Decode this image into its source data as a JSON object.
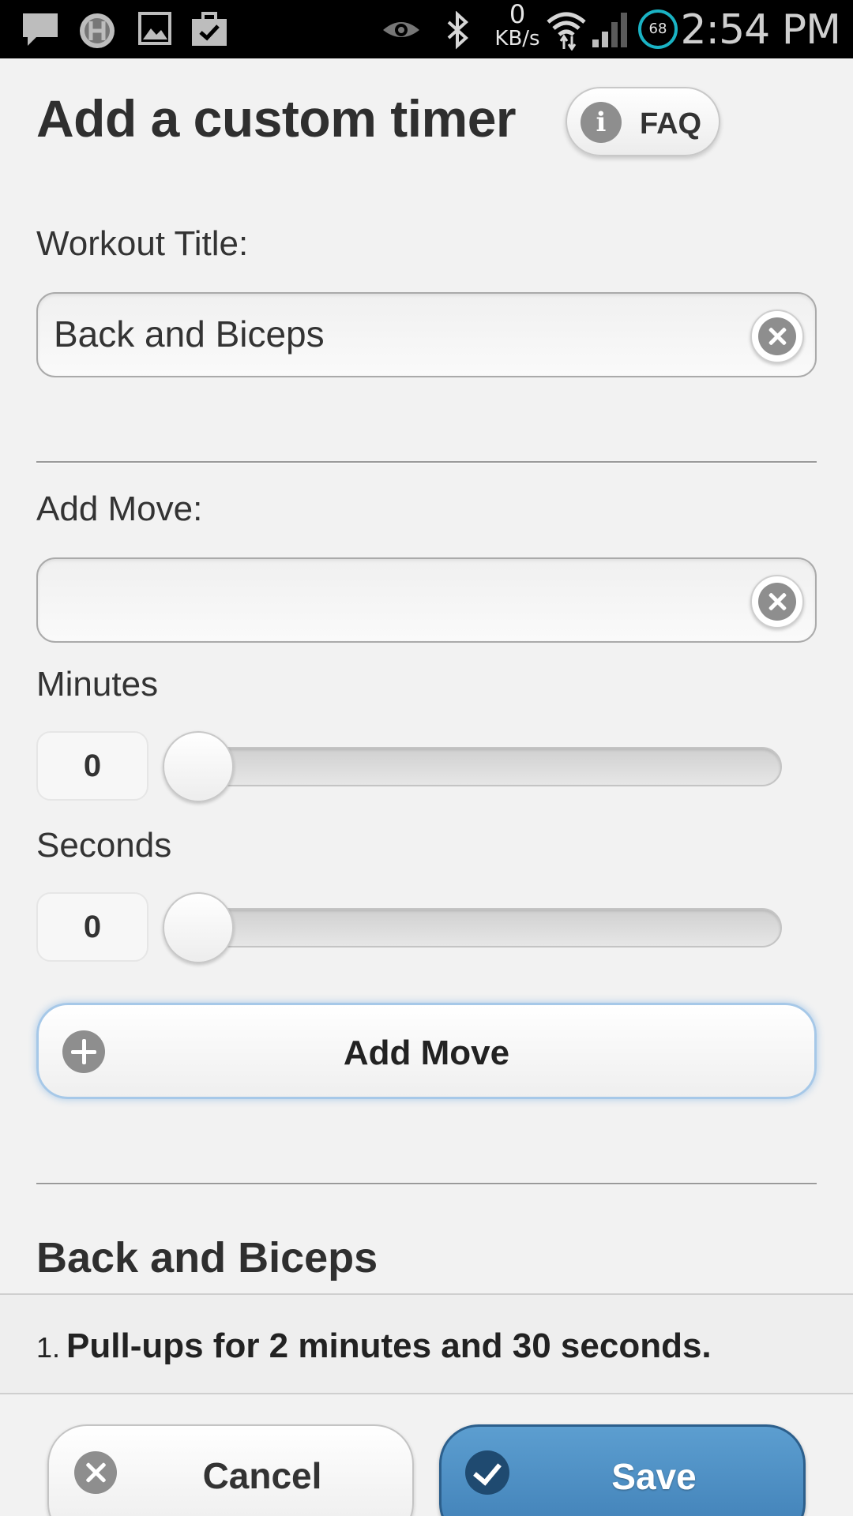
{
  "status_bar": {
    "net_speed_value": "0",
    "net_speed_unit": "KB/s",
    "battery": "68",
    "time": "2:54 PM",
    "icons": [
      "chat-icon",
      "h-badge-icon",
      "image-icon",
      "briefcase-check-icon",
      "eye-icon",
      "bluetooth-icon",
      "wifi-icon",
      "signal-icon",
      "battery-icon"
    ]
  },
  "header": {
    "title": "Add a custom timer",
    "faq_label": "FAQ"
  },
  "form": {
    "workout_title_label": "Workout Title:",
    "workout_title_value": "Back and Biceps",
    "add_move_label": "Add Move:",
    "add_move_value": "",
    "minutes_label": "Minutes",
    "minutes_value": "0",
    "seconds_label": "Seconds",
    "seconds_value": "0",
    "add_move_button": "Add Move"
  },
  "workout": {
    "title": "Back and Biceps",
    "moves": [
      {
        "number": "1.",
        "text": "Pull-ups for 2 minutes and 30 seconds."
      }
    ]
  },
  "footer": {
    "cancel_label": "Cancel",
    "save_label": "Save"
  },
  "colors": {
    "accent_blue": "#4a8cc4",
    "battery_ring": "#1ab3c4"
  }
}
